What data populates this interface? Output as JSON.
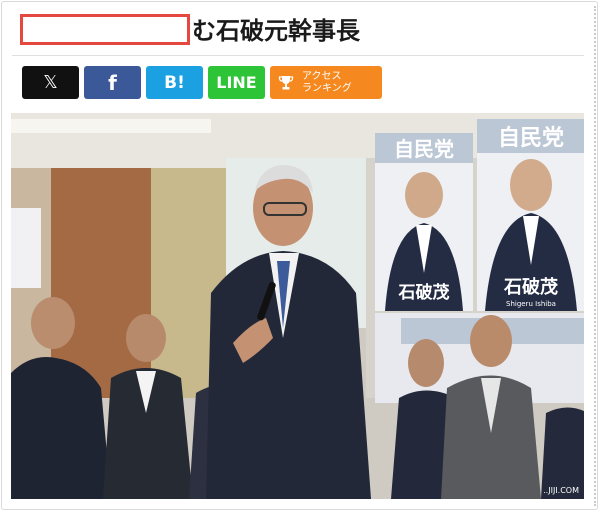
{
  "article": {
    "title_visible": "む石破元幹事長",
    "title_redacted": true
  },
  "share": {
    "x_label": "𝕏",
    "facebook_label": "f",
    "hatena_label": "B!",
    "line_label": "LINE",
    "ranking_line1": "アクセス",
    "ranking_line2": "ランキング"
  },
  "photo": {
    "poster_party": "自民党",
    "poster_name": "石破茂",
    "poster_name_roman": "Shigeru Ishiba",
    "watermark": "..JIJI.COM"
  },
  "colors": {
    "x": "#111111",
    "facebook": "#3b5998",
    "hatena": "#1ba1e2",
    "line": "#2ec437",
    "ranking": "#f5891f",
    "redaction": "#e5483f"
  }
}
